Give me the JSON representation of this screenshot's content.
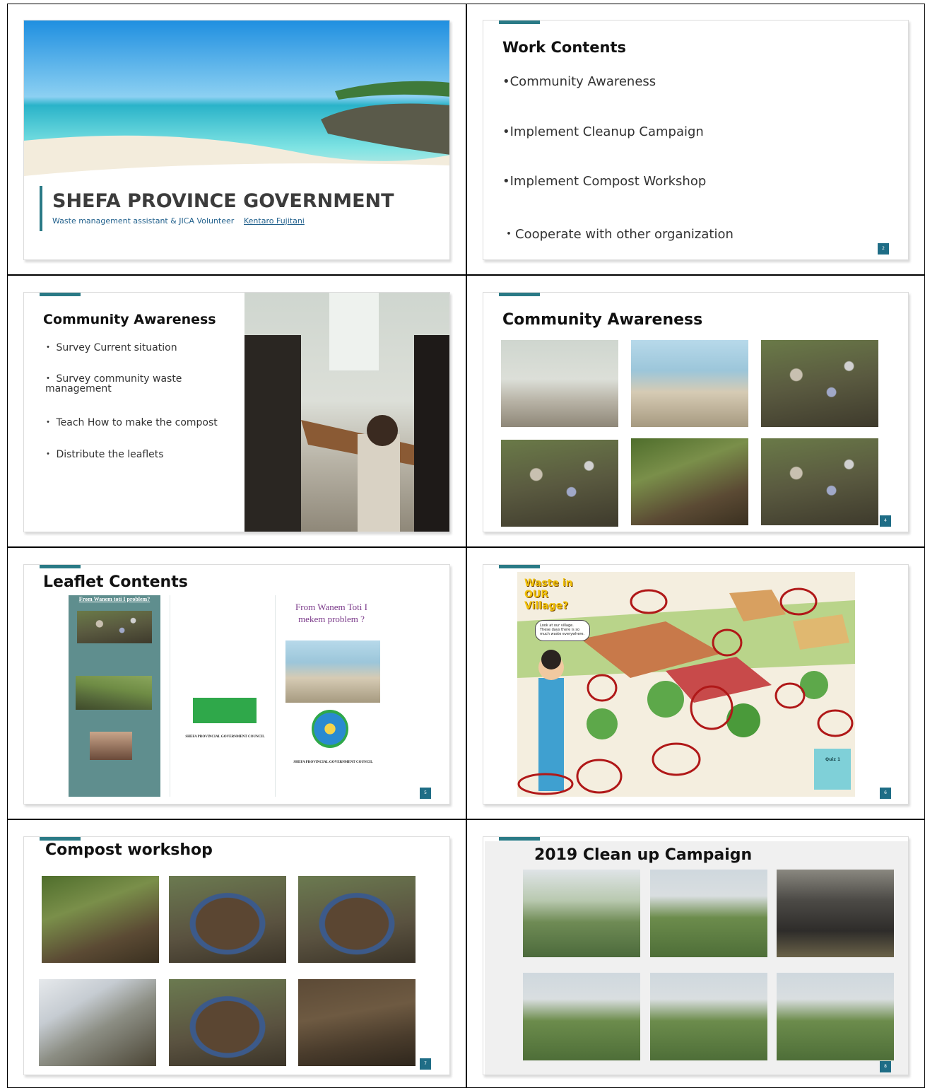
{
  "slides": {
    "s1": {
      "title": "SHEFA PROVINCE GOVERNMENT",
      "subtitle_role": "Waste management assistant & JICA Volunteer",
      "subtitle_name": "Kentaro Fujitani"
    },
    "s2": {
      "title": "Work Contents",
      "bullets": [
        "•Community Awareness",
        "•Implement Cleanup Campaign",
        "•Implement Compost Workshop",
        "・Cooperate with other organization"
      ],
      "page": "2"
    },
    "s3": {
      "title": "Community Awareness",
      "bullets": [
        "・ Survey Current situation",
        "・ Survey community waste",
        "management",
        "・ Teach How to make the compost",
        "・ Distribute the leaflets"
      ]
    },
    "s4": {
      "title": "Community Awareness",
      "page": "4"
    },
    "s5": {
      "title": "Leaflet Contents",
      "leaflet_left_heading": "From Wanem toti I problem?",
      "leaflet_right_heading": "From Wanem Toti I mekem problem ?",
      "council": "SHEFA PROVINCIAL GOVERNMENT COUNCIL",
      "page": "5"
    },
    "s6": {
      "poster_title": "Waste in OUR Village?",
      "speech": "Look at our village. These days there is so much waste everywhere.",
      "quiz": "Quiz 1",
      "page": "6"
    },
    "s7": {
      "title": "Compost workshop",
      "page": "7"
    },
    "s8": {
      "title": "2019 Clean up Campaign",
      "page": "8"
    }
  }
}
